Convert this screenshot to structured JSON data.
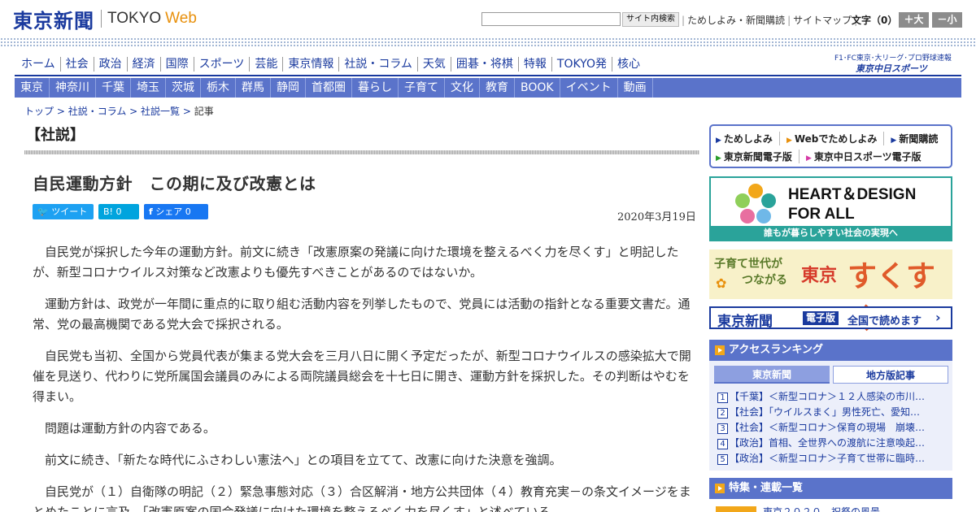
{
  "header": {
    "logo_jp": "東京新聞",
    "logo_en": "TOKYO",
    "logo_web": "Web",
    "search_button": "サイト内検索",
    "links": [
      "ためしよみ・新聞購読",
      "サイトマップ"
    ],
    "font_size_label": "文字（0）",
    "font_up": "＋大",
    "font_down": "－小"
  },
  "main_nav": [
    "ホーム",
    "社会",
    "政治",
    "経済",
    "国際",
    "スポーツ",
    "芸能",
    "東京情報",
    "社説・コラム",
    "天気",
    "囲碁・将棋",
    "特報",
    "TOKYO発",
    "核心"
  ],
  "sports": {
    "label": "F1･FC東京･大リーグ･プロ野球速報",
    "logo": "東京中日スポーツ"
  },
  "region_nav": [
    "東京",
    "神奈川",
    "千葉",
    "埼玉",
    "茨城",
    "栃木",
    "群馬",
    "静岡",
    "首都圏",
    "暮らし",
    "子育て",
    "文化",
    "教育",
    "BOOK",
    "イベント",
    "動画"
  ],
  "breadcrumb": [
    "トップ",
    "社説・コラム",
    "社説一覧",
    "記事"
  ],
  "article": {
    "section": "【社説】",
    "title": "自民運動方針　この期に及び改憲とは",
    "date": "2020年3月19日",
    "share": {
      "tweet": "ツイート",
      "hatena": "B! 0",
      "facebook": "シェア 0"
    },
    "paragraphs": [
      "自民党が採択した今年の運動方針。前文に続き「改憲原案の発議に向けた環境を整えるべく力を尽くす」と明記したが、新型コロナウイルス対策など改憲よりも優先すべきことがあるのではないか。",
      "運動方針は、政党が一年間に重点的に取り組む活動内容を列挙したもので、党員には活動の指針となる重要文書だ。通常、党の最高機関である党大会で採択される。",
      "自民党も当初、全国から党員代表が集まる党大会を三月八日に開く予定だったが、新型コロナウイルスの感染拡大で開催を見送り、代わりに党所属国会議員のみによる両院議員総会を十七日に開き、運動方針を採択した。その判断はやむを得まい。",
      "問題は運動方針の内容である。",
      "前文に続き、「新たな時代にふさわしい憲法へ」との項目を立てて、改憲に向けた決意を強調。",
      "自民党が（１）自衛隊の明記（２）緊急事態対応（３）合区解消・地方公共団体（４）教育充実－の条文イメージをまとめたことに言及、「改憲原案の国会発議に向けた環境を整えるべく力を尽くす」と述べている。"
    ]
  },
  "sidebar": {
    "links_row1": [
      "ためしよみ",
      "Webでためしよみ",
      "新聞購読"
    ],
    "links_row2": [
      "東京新聞電子版",
      "東京中日スポーツ電子版"
    ],
    "heart_title_1": "HEART＆DESIGN",
    "heart_title_2": "FOR ALL",
    "heart_sub": "誰もが暮らしやすい社会の実現へ",
    "suku_left_1": "子育て世代が",
    "suku_left_2": "つながる",
    "suku_tokyo": "東京",
    "suku_main": "すくすく",
    "digital_name": "東京新聞",
    "digital_badge": "電子版",
    "digital_text": "全国で読めます",
    "ranking_header": "アクセスランキング",
    "ranking_tabs": [
      "東京新聞",
      "地方版記事"
    ],
    "ranking": [
      "【千葉】＜新型コロナ＞１２人感染の市川…",
      "【社会】「ウイルスまく」男性死亡、愛知…",
      "【社会】＜新型コロナ＞保育の現場　崩壊…",
      "【政治】首相、全世界への渡航に注意喚起…",
      "【政治】＜新型コロナ＞子育て世帯に臨時…"
    ],
    "feature_header": "特集・連載一覧",
    "feature_item": "東京２０２０　祝祭の風景"
  },
  "colors": {
    "brand": "#1a3a9e",
    "nav": "#5a73ca",
    "accent": "#e8900c",
    "teal": "#2aa39a"
  }
}
